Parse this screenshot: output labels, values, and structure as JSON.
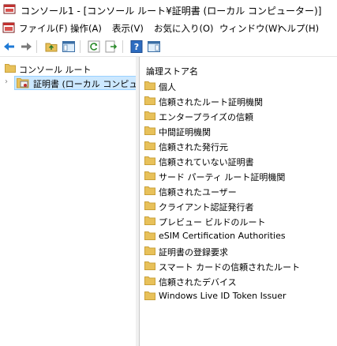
{
  "window": {
    "title": "コンソール1 - [コンソール ルート¥証明書 (ローカル コンピューター)]"
  },
  "menu": [
    "ファイル(F)",
    "操作(A)",
    "表示(V)",
    "お気に入り(O)",
    "ウィンドウ(W)",
    "ヘルプ(H)"
  ],
  "tree": {
    "root": "コンソール ルート",
    "child": "証明書 (ローカル コンピュータ"
  },
  "list": {
    "header": "論理ストア名",
    "items": [
      "個人",
      "信頼されたルート証明機関",
      "エンタープライズの信頼",
      "中間証明機関",
      "信頼された発行元",
      "信頼されていない証明書",
      "サード パーティ ルート証明機関",
      "信頼されたユーザー",
      "クライアント認証発行者",
      "プレビュー ビルドのルート",
      "eSIM Certification Authorities",
      "証明書の登録要求",
      "スマート カードの信頼されたルート",
      "信頼されたデバイス",
      "Windows Live ID Token Issuer"
    ]
  },
  "icons": {
    "folder_color": "#e8c15a",
    "folder_edge": "#c9a13a",
    "back_arrow_color": "#1f7ad6",
    "forward_arrow_color": "#7a7a7a"
  }
}
